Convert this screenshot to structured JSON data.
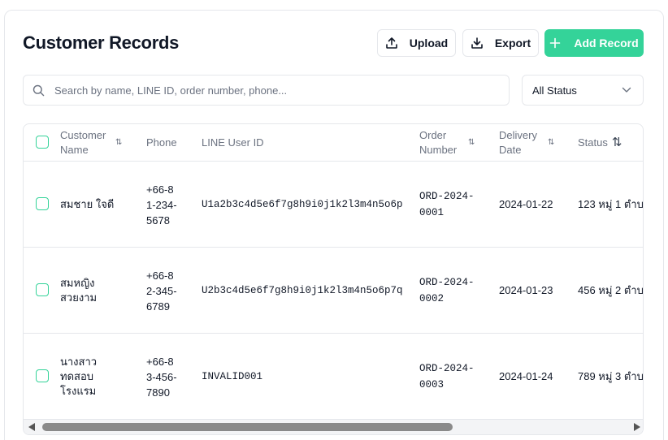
{
  "header": {
    "title": "Customer Records",
    "upload_label": "Upload",
    "export_label": "Export",
    "add_label": "Add Record"
  },
  "search": {
    "placeholder": "Search by name, LINE ID, order number, phone..."
  },
  "status_filter": {
    "selected": "All Status"
  },
  "table": {
    "columns": [
      "Customer Name",
      "Phone",
      "LINE User ID",
      "Order Number",
      "Delivery Date",
      "Status"
    ],
    "sort_icon": "⇅",
    "rows": [
      {
        "name": "สมชาย ใจดี",
        "phone": "+66-81-234-5678",
        "line_id": "U1a2b3c4d5e6f7g8h9i0j1k2l3m4n5o6p",
        "order": "ORD-2024-0001",
        "delivery": "2024-01-22",
        "status": "123 หมู่ 1 ตำบ"
      },
      {
        "name": "สมหญิง สวยงาม",
        "phone": "+66-82-345-6789",
        "line_id": "U2b3c4d5e6f7g8h9i0j1k2l3m4n5o6p7q",
        "order": "ORD-2024-0002",
        "delivery": "2024-01-23",
        "status": "456 หมู่ 2 ตำบ"
      },
      {
        "name": "นางสาว ทดสอบ โรงแรม",
        "phone": "+66-83-456-7890",
        "line_id": "INVALID001",
        "order": "ORD-2024-0003",
        "delivery": "2024-01-24",
        "status": "789 หมู่ 3 ตำบ"
      }
    ]
  },
  "colors": {
    "accent": "#34d399",
    "border": "#e5e7eb",
    "muted_text": "#6b7280"
  }
}
